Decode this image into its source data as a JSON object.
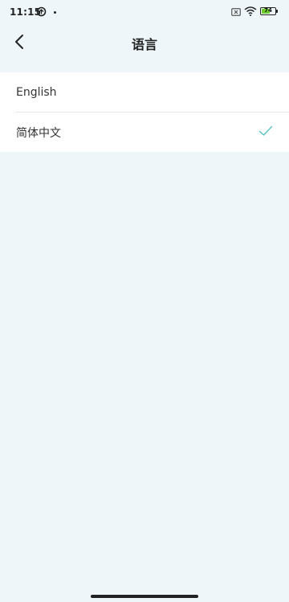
{
  "status_bar": {
    "time": "11:15",
    "battery_level": "74",
    "battery_fraction": 0.74,
    "battery_color": "#6ecb2e"
  },
  "nav": {
    "title": "语言",
    "back_icon": "chevron-left-icon"
  },
  "languages": {
    "items": [
      {
        "label": "English",
        "selected": false
      },
      {
        "label": "简体中文",
        "selected": true
      }
    ],
    "check_icon": "checkmark-icon",
    "check_color": "#59c3c3"
  },
  "colors": {
    "background": "#eef6f9",
    "list_background": "#ffffff",
    "text": "#333333"
  }
}
